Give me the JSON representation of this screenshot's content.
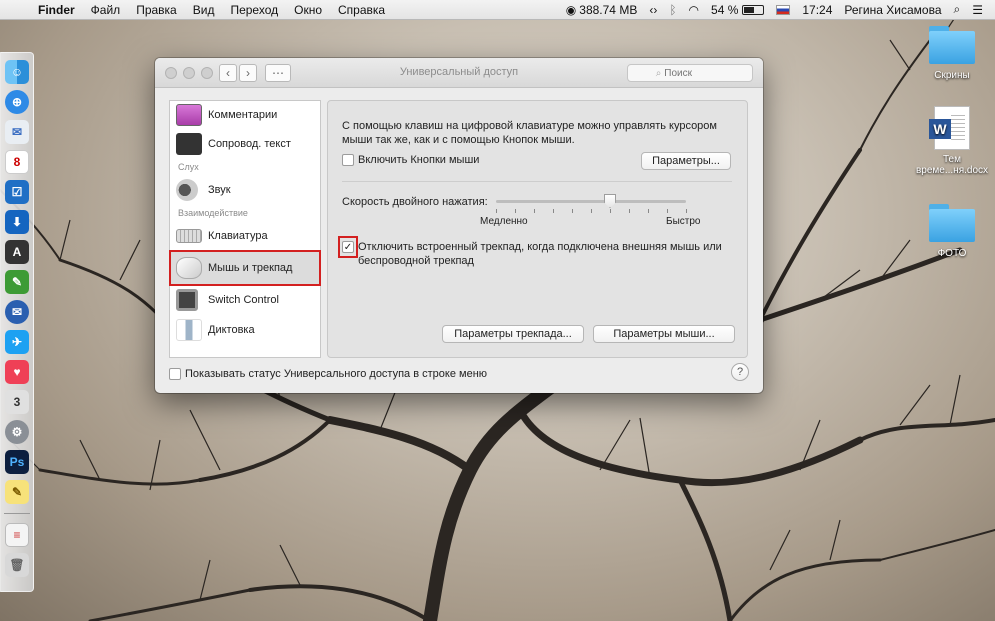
{
  "menubar": {
    "app": "Finder",
    "menus": [
      "Файл",
      "Правка",
      "Вид",
      "Переход",
      "Окно",
      "Справка"
    ],
    "memory": "388.74 MB",
    "battery": "54 %",
    "time": "17:24",
    "user": "Регина Хисамова"
  },
  "desktop": {
    "items": [
      {
        "label": "Скрины",
        "type": "folder"
      },
      {
        "label": "Тем време...ня.docx",
        "type": "docx"
      },
      {
        "label": "ФОТО",
        "type": "folder"
      }
    ]
  },
  "window": {
    "title": "Универсальный доступ",
    "search_placeholder": "Поиск",
    "sidebar": {
      "items": [
        {
          "label": "Комментарии"
        },
        {
          "label": "Сопровод. текст"
        },
        {
          "category": "Слух"
        },
        {
          "label": "Звук"
        },
        {
          "category": "Взаимодействие"
        },
        {
          "label": "Клавиатура"
        },
        {
          "label": "Мышь и трекпад",
          "selected": true
        },
        {
          "label": "Switch Control"
        },
        {
          "label": "Диктовка"
        }
      ]
    },
    "panel": {
      "description": "С помощью клавиш на цифровой клавиатуре можно управлять курсором мыши так же, как и с помощью Кнопок мыши.",
      "enable_mouse_keys_label": "Включить Кнопки мыши",
      "enable_mouse_keys_checked": false,
      "options_button": "Параметры...",
      "double_click_label": "Скорость двойного нажатия:",
      "slow_label": "Медленно",
      "fast_label": "Быстро",
      "double_click_speed": 0.6,
      "ignore_trackpad_label": "Отключить встроенный трекпад, когда подключена внешняя мышь или беспроводной трекпад",
      "ignore_trackpad_checked": true,
      "trackpad_options_button": "Параметры трекпада...",
      "mouse_options_button": "Параметры мыши..."
    },
    "show_status_label": "Показывать статус Универсального доступа в строке меню",
    "show_status_checked": false,
    "help": "?"
  },
  "colors": {
    "highlight": "#d32020",
    "folder": "#3aa2e2"
  }
}
